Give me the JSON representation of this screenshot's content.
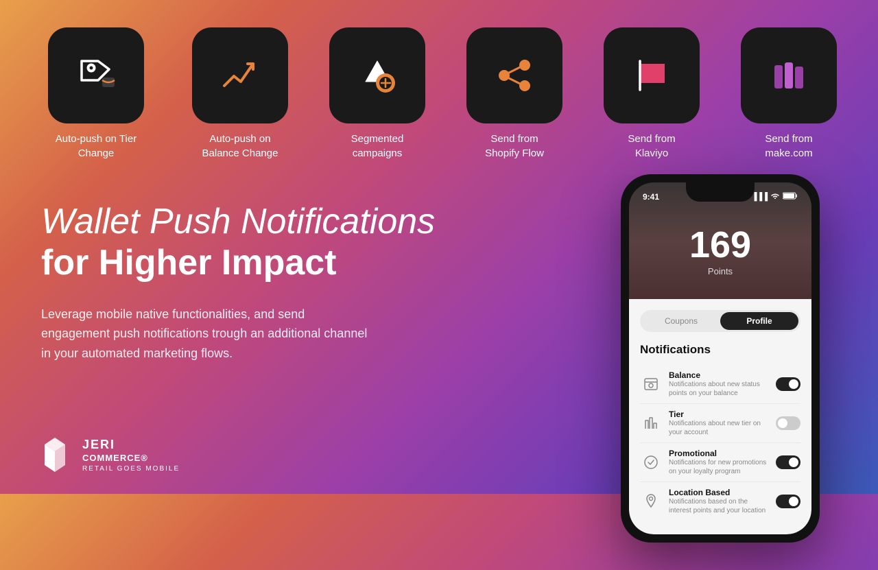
{
  "features": [
    {
      "id": "auto-push-tier",
      "label": "Auto-push on\nTier Change",
      "icon_type": "tag"
    },
    {
      "id": "auto-push-balance",
      "label": "Auto-push on\nBalance Change",
      "icon_type": "chart"
    },
    {
      "id": "segmented-campaigns",
      "label": "Segmented\ncampaigns",
      "icon_type": "shapes"
    },
    {
      "id": "send-shopify",
      "label": "Send from\nShopify Flow",
      "icon_type": "flow"
    },
    {
      "id": "send-klaviyo",
      "label": "Send from\nKlaviyo",
      "icon_type": "flag"
    },
    {
      "id": "send-make",
      "label": "Send from\nmake.com",
      "icon_type": "books"
    }
  ],
  "heading": {
    "italic": "Wallet Push Notifications",
    "bold": "for Higher Impact"
  },
  "description": "Leverage mobile native functionalities, and send engagement push notifications trough an additional channel in your automated marketing flows.",
  "logo": {
    "brand": "JERI",
    "commerce": "COMMERCE®",
    "tagline": "RETAIL GOES MOBILE"
  },
  "phone": {
    "time": "9:41",
    "signal": "▐▐▐",
    "wifi": "WiFi",
    "battery": "■■",
    "points_number": "169",
    "points_label": "Points",
    "tab_coupons": "Coupons",
    "tab_profile": "Profile",
    "notifications_title": "Notifications",
    "notifications": [
      {
        "title": "Balance",
        "desc": "Notifications about new status points on your balance",
        "toggled": true
      },
      {
        "title": "Tier",
        "desc": "Notifications about new tier on your account",
        "toggled": false
      },
      {
        "title": "Promotional",
        "desc": "Notifications for new promotions on your loyalty program",
        "toggled": true
      },
      {
        "title": "Location Based",
        "desc": "Notifications based on the interest points and your location",
        "toggled": true
      }
    ]
  },
  "colors": {
    "accent_orange": "#e8833a",
    "accent_pink": "#e0406a",
    "accent_purple": "#9b3fa8",
    "icon_bg": "#1a1a1a"
  }
}
